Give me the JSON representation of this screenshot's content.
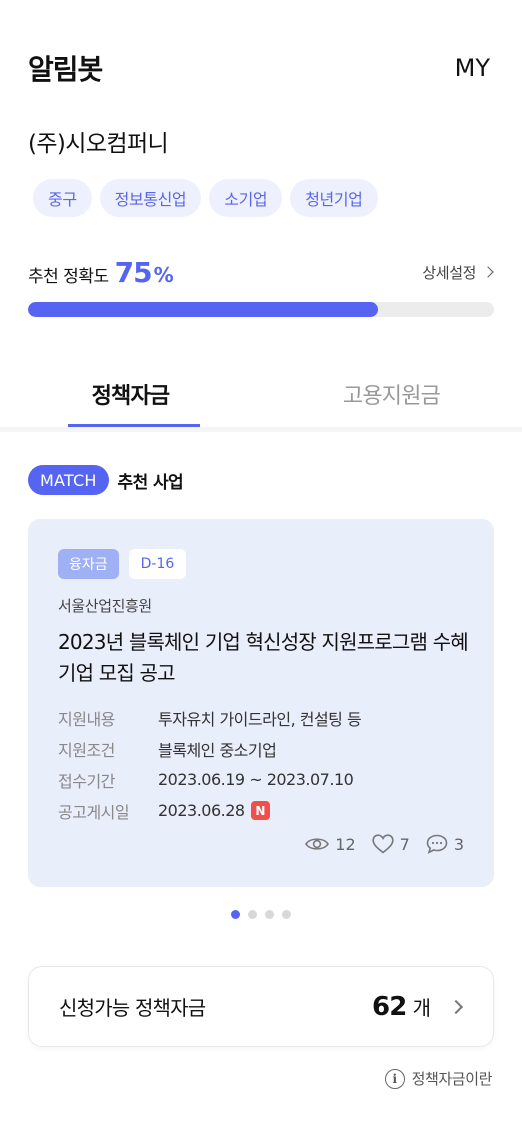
{
  "header": {
    "title": "알림봇",
    "my_label": "MY"
  },
  "company": {
    "name": "(주)시오컴퍼니"
  },
  "tags": [
    "중구",
    "정보통신업",
    "소기업",
    "청년기업"
  ],
  "accuracy": {
    "label": "추천 정확도",
    "value": "75",
    "unit": "%",
    "progress": 0.75,
    "settings_label": "상세설정"
  },
  "tabs": [
    {
      "label": "정책자금",
      "active": true
    },
    {
      "label": "고용지원금",
      "active": false
    }
  ],
  "section": {
    "badge": "MATCH",
    "title": "추천 사업"
  },
  "card": {
    "type_badge": "융자금",
    "dday_badge": "D-16",
    "org": "서울산업진흥원",
    "title": "2023년 블록체인 기업 혁신성장 지원프로그램 수혜기업 모집 공고",
    "info": [
      {
        "key": "지원내용",
        "value": "투자유치 가이드라인, 컨설팅 등"
      },
      {
        "key": "지원조건",
        "value": "블록체인 중소기업"
      },
      {
        "key": "접수기간",
        "value": "2023.06.19 ~ 2023.07.10"
      },
      {
        "key": "공고게시일",
        "value": "2023.06.28",
        "new_badge": "N"
      }
    ],
    "stats": {
      "views": "12",
      "likes": "7",
      "comments": "3"
    }
  },
  "pagination": {
    "total": 4,
    "active_index": 0
  },
  "summary": {
    "label": "신청가능 정책자금",
    "count": "62",
    "unit": "개"
  },
  "help": {
    "label": "정책자금이란",
    "icon_glyph": "i"
  },
  "colors": {
    "accent": "#5565f2",
    "tag_bg": "#eef1fd",
    "card_bg": "#e9eefb",
    "new_badge": "#f0504d"
  }
}
